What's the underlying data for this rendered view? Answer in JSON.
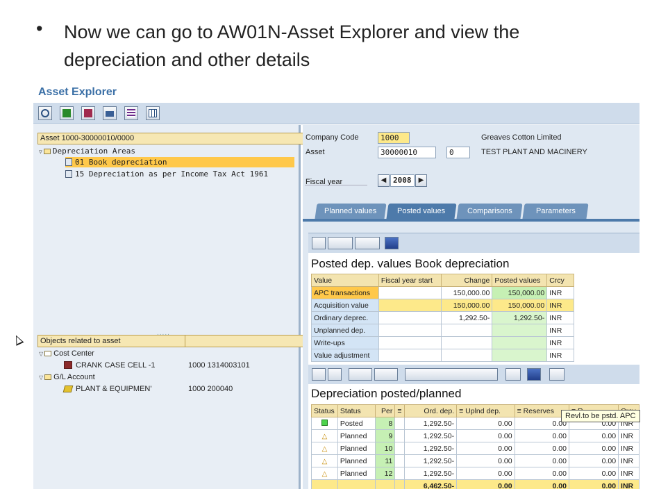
{
  "slide": {
    "bullet": "•",
    "text": "Now we can go to AW01N-Asset Explorer and view the depreciation and other details"
  },
  "app": {
    "title": "Asset Explorer"
  },
  "toolbar": {
    "buttons": [
      "refresh-icon",
      "asset-icon",
      "display-icon",
      "print-icon",
      "list-icon",
      "layout-icon"
    ]
  },
  "left": {
    "tree_header": "Asset 1000-30000010/0000",
    "depr_areas_label": "Depreciation Areas",
    "areas": [
      {
        "label": "01 Book depreciation",
        "selected": true
      },
      {
        "label": "15 Depreciation as per Income Tax  Act 1961",
        "selected": false
      }
    ],
    "related_header": "Objects related to asset",
    "cost_center_label": "Cost Center",
    "cost_center_item": "CRANK CASE CELL -1",
    "cost_center_value": "1000 1314003101",
    "gl_label": "G/L Account",
    "gl_item": "PLANT & EQUIPMEN'",
    "gl_value": "1000 200040"
  },
  "header_fields": {
    "company_code_label": "Company Code",
    "company_code": "1000",
    "company_name": "Greaves Cotton Limited",
    "asset_label": "Asset",
    "asset_number": "30000010",
    "asset_sub": "0",
    "asset_name": "TEST PLANT AND MACINERY",
    "fiscal_year_label": "Fiscal year",
    "fiscal_year": "2008"
  },
  "tabs": [
    {
      "label": "Planned values",
      "active": false
    },
    {
      "label": "Posted values",
      "active": true
    },
    {
      "label": "Comparisons",
      "active": false
    },
    {
      "label": "Parameters",
      "active": false
    }
  ],
  "posted": {
    "title": "Posted dep. values Book depreciation",
    "columns": [
      "Value",
      "Fiscal year start",
      "Change",
      "Posted values",
      "Crcy"
    ],
    "rows": [
      {
        "label": "APC transactions",
        "start": "",
        "change": "150,000.00",
        "posted": "150,000.00",
        "crcy": "INR"
      },
      {
        "label": "Acquisition value",
        "start": "",
        "change": "150,000.00",
        "posted": "150,000.00",
        "crcy": "INR"
      },
      {
        "label": "Ordinary deprec.",
        "start": "",
        "change": "1,292.50-",
        "posted": "1,292.50-",
        "crcy": "INR"
      },
      {
        "label": "Unplanned dep.",
        "start": "",
        "change": "",
        "posted": "",
        "crcy": "INR"
      },
      {
        "label": "Write-ups",
        "start": "",
        "change": "",
        "posted": "",
        "crcy": "INR"
      },
      {
        "label": "Value adjustment",
        "start": "",
        "change": "",
        "posted": "",
        "crcy": "INR"
      }
    ]
  },
  "planned": {
    "title": "Depreciation posted/planned",
    "columns": [
      "Status",
      "Status",
      "Per",
      "≡",
      "Ord. dep.",
      "≡ Uplnd dep.",
      "≡ Reserves",
      "≡ R",
      "Crcy"
    ],
    "rows": [
      {
        "icon": "posted",
        "status": "Posted",
        "per": "8",
        "ord": "1,292.50-",
        "unpl": "0.00",
        "res": "0.00",
        "reval": "0.00",
        "crcy": "INR"
      },
      {
        "icon": "planned",
        "status": "Planned",
        "per": "9",
        "ord": "1,292.50-",
        "unpl": "0.00",
        "res": "0.00",
        "reval": "0.00",
        "crcy": "INR"
      },
      {
        "icon": "planned",
        "status": "Planned",
        "per": "10",
        "ord": "1,292.50-",
        "unpl": "0.00",
        "res": "0.00",
        "reval": "0.00",
        "crcy": "INR"
      },
      {
        "icon": "planned",
        "status": "Planned",
        "per": "11",
        "ord": "1,292.50-",
        "unpl": "0.00",
        "res": "0.00",
        "reval": "0.00",
        "crcy": "INR"
      },
      {
        "icon": "planned",
        "status": "Planned",
        "per": "12",
        "ord": "1,292.50-",
        "unpl": "0.00",
        "res": "0.00",
        "reval": "0.00",
        "crcy": "INR"
      }
    ],
    "total": {
      "ord": "6,462.50-",
      "unpl": "0.00",
      "res": "0.00",
      "reval": "0.00",
      "crcy": "INR"
    }
  },
  "tooltip": "Revl.to be pstd. APC",
  "colors": {
    "accent": "#4d7aaa",
    "highlight": "#ffc84a",
    "header": "#f3e4b0"
  }
}
